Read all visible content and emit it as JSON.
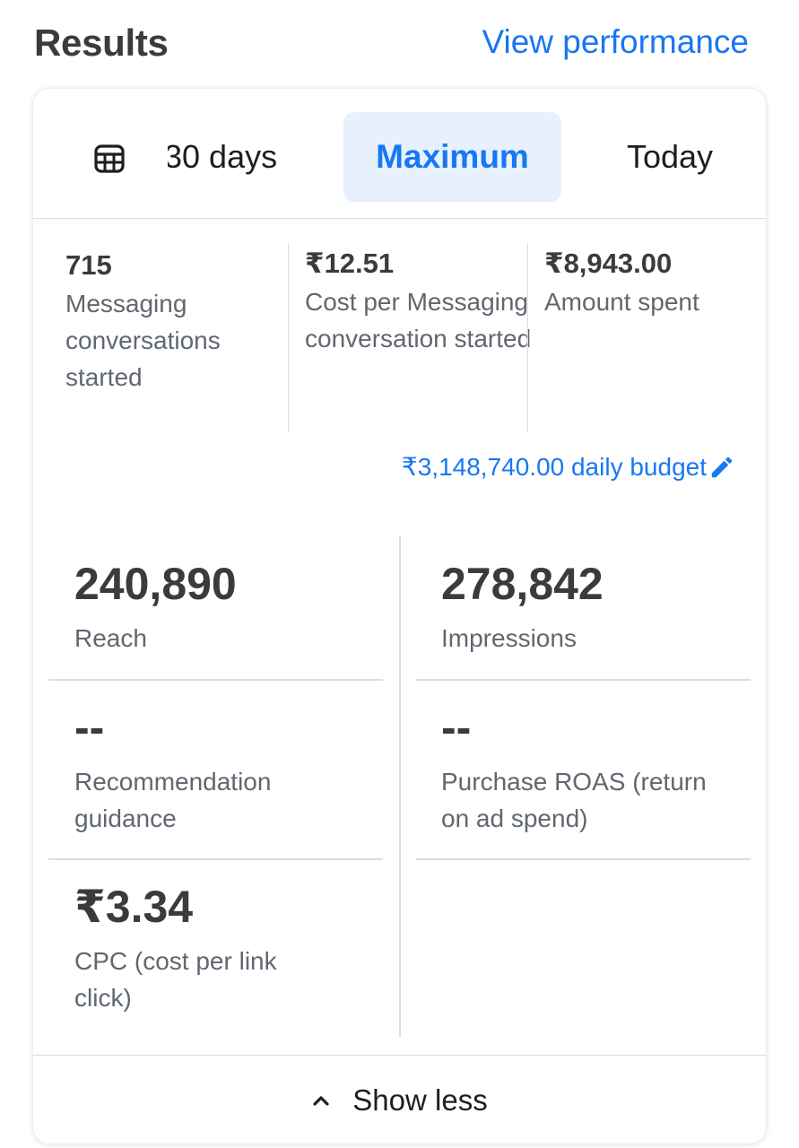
{
  "header": {
    "title": "Results",
    "view_link": "View performance"
  },
  "tabs": {
    "calendar_icon": "calendar-grid-icon",
    "days_label": "30 days",
    "maximum_label": "Maximum",
    "today_label": "Today",
    "selected": "Maximum"
  },
  "summary": [
    {
      "value": "715",
      "label": "Messaging conversations started"
    },
    {
      "value": "₹12.51",
      "label": "Cost per Messaging conversation started"
    },
    {
      "value": "₹8,943.00",
      "label": "Amount spent"
    }
  ],
  "budget": {
    "label": "₹3,148,740.00 daily budget",
    "icon": "pencil-icon"
  },
  "metrics": {
    "reach": {
      "value": "240,890",
      "label": "Reach"
    },
    "impressions": {
      "value": "278,842",
      "label": "Impressions"
    },
    "recommendation": {
      "value": "--",
      "label": "Recommendation guidance"
    },
    "roas": {
      "value": "--",
      "label": "Purchase ROAS (return on ad spend)"
    },
    "cpc": {
      "value": "₹3.34",
      "label": "CPC (cost per link click)"
    }
  },
  "footer": {
    "show_less_label": "Show less",
    "icon": "chevron-up-icon"
  },
  "colors": {
    "accent": "#1877f2",
    "selected_tab_bg": "#e7f1fd",
    "text_primary": "#3a3b3c",
    "text_secondary": "#606770",
    "divider": "#dadde1"
  }
}
